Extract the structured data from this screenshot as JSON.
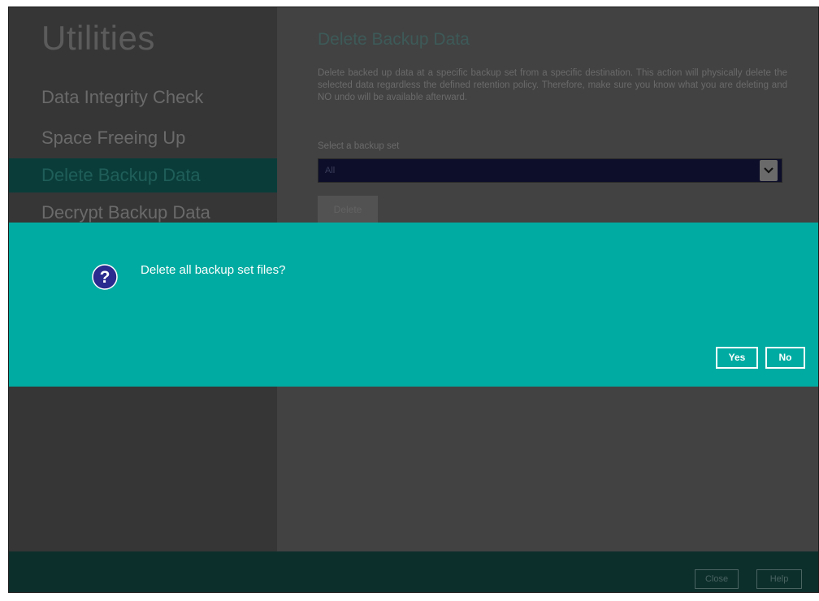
{
  "sidebar": {
    "title": "Utilities",
    "items": [
      {
        "label": "Data Integrity Check"
      },
      {
        "label": "Space Freeing Up"
      },
      {
        "label": "Delete Backup Data"
      },
      {
        "label": "Decrypt Backup Data"
      }
    ]
  },
  "content": {
    "title": "Delete Backup Data",
    "description": "Delete backed up data at a specific backup set from a specific destination. This action will physically delete the selected data regardless the defined retention policy. Therefore, make sure you know what you are deleting and NO undo will be available afterward.",
    "select_label": "Select a backup set",
    "select_value": "All",
    "delete_button": "Delete"
  },
  "dialog": {
    "icon": "question-icon",
    "message": "Delete all backup set files?",
    "yes_label": "Yes",
    "no_label": "No"
  },
  "footer": {
    "close_label": "Close",
    "help_label": "Help"
  },
  "colors": {
    "dialog_bg": "#00aba1",
    "footer_bg": "#0d2f2c",
    "active_item_bg": "#0a3d3a"
  }
}
